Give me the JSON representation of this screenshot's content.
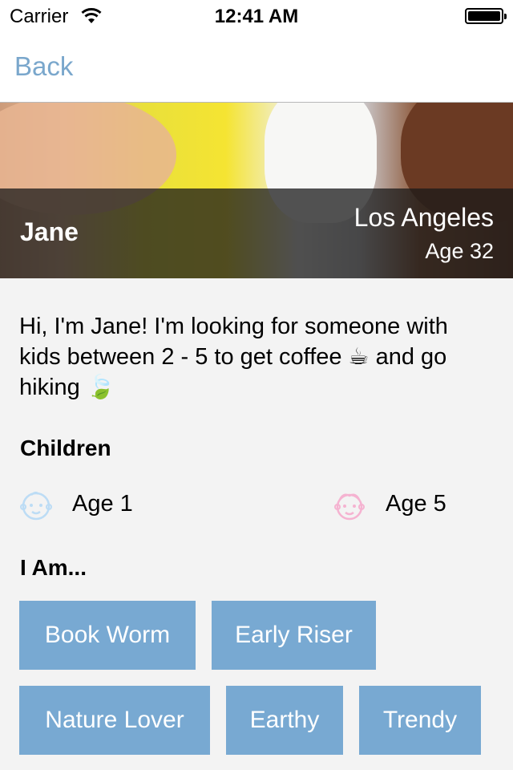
{
  "status_bar": {
    "carrier": "Carrier",
    "time": "12:41 AM"
  },
  "nav": {
    "back_label": "Back"
  },
  "profile": {
    "name": "Jane",
    "city": "Los Angeles",
    "age": "Age 32"
  },
  "bio": "Hi, I'm Jane! I'm looking for someone with kids between 2 - 5 to get coffee ☕ and go hiking 🍃",
  "children": {
    "title": "Children",
    "items": [
      {
        "label": "Age 1",
        "icon": "baby-boy-face-icon",
        "color": "#c7e2f7"
      },
      {
        "label": "Age 5",
        "icon": "baby-girl-face-icon",
        "color": "#f7b9d6"
      }
    ]
  },
  "traits": {
    "title": "I Am...",
    "tags": [
      "Book Worm",
      "Early Riser",
      "Nature Lover",
      "Earthy",
      "Trendy"
    ]
  },
  "colors": {
    "accent": "#7aa7cc",
    "tag_bg": "#78a9d2"
  }
}
